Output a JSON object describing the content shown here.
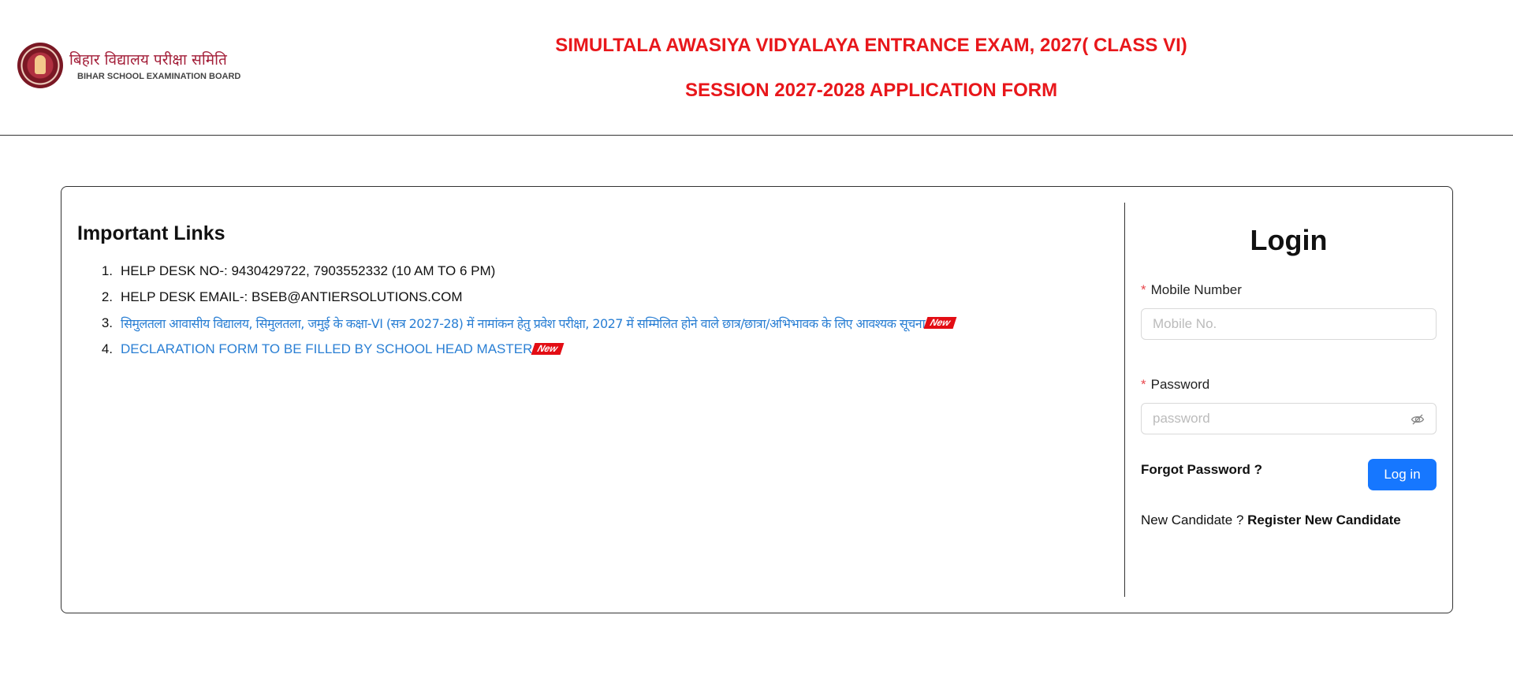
{
  "header": {
    "logo_hindi": "बिहार विद्यालय परीक्षा समिति",
    "logo_english": "BIHAR SCHOOL EXAMINATION BOARD",
    "title_line1": "SIMULTALA AWASIYA VIDYALAYA ENTRANCE EXAM, 2027( CLASS VI)",
    "title_line2": "SESSION 2027-2028 APPLICATION FORM"
  },
  "links": {
    "heading": "Important Links",
    "items": [
      {
        "number": "1.",
        "text": "HELP DESK NO-: 9430429722, 7903552332 (10 AM TO 6 PM)",
        "is_link": false,
        "badge": ""
      },
      {
        "number": "2.",
        "text": "HELP DESK EMAIL-: BSEB@ANTIERSOLUTIONS.COM",
        "is_link": false,
        "badge": ""
      },
      {
        "number": "3.",
        "text": "सिमुलतला आवासीय विद्यालय, सिमुलतला, जमुई के कक्षा-VI (सत्र 2027-28) में नामांकन हेतु प्रवेश परीक्षा, 2027 में सम्मिलित होने वाले छात्र/छात्रा/अभिभावक के लिए आवश्यक सूचना",
        "is_link": true,
        "badge": "New"
      },
      {
        "number": "4.",
        "text": "DECLARATION FORM TO BE FILLED BY SCHOOL HEAD MASTER",
        "is_link": true,
        "badge": "New"
      }
    ]
  },
  "login": {
    "title": "Login",
    "mobile_label": "Mobile Number",
    "mobile_placeholder": "Mobile No.",
    "mobile_value": "",
    "password_label": "Password",
    "password_placeholder": "password",
    "password_value": "",
    "required_marker": "*",
    "forgot_label": "Forgot Password ?",
    "login_button": "Log in",
    "new_candidate_text": "New Candidate ?",
    "register_label": "Register New Candidate"
  },
  "colors": {
    "title_red": "#e8171b",
    "link_blue": "#2a7fd4",
    "badge_red": "#e30d14",
    "button_blue": "#1677ff"
  },
  "icons": {
    "logo": "bseb-seal-logo",
    "password_toggle": "eye-invisible-icon"
  }
}
